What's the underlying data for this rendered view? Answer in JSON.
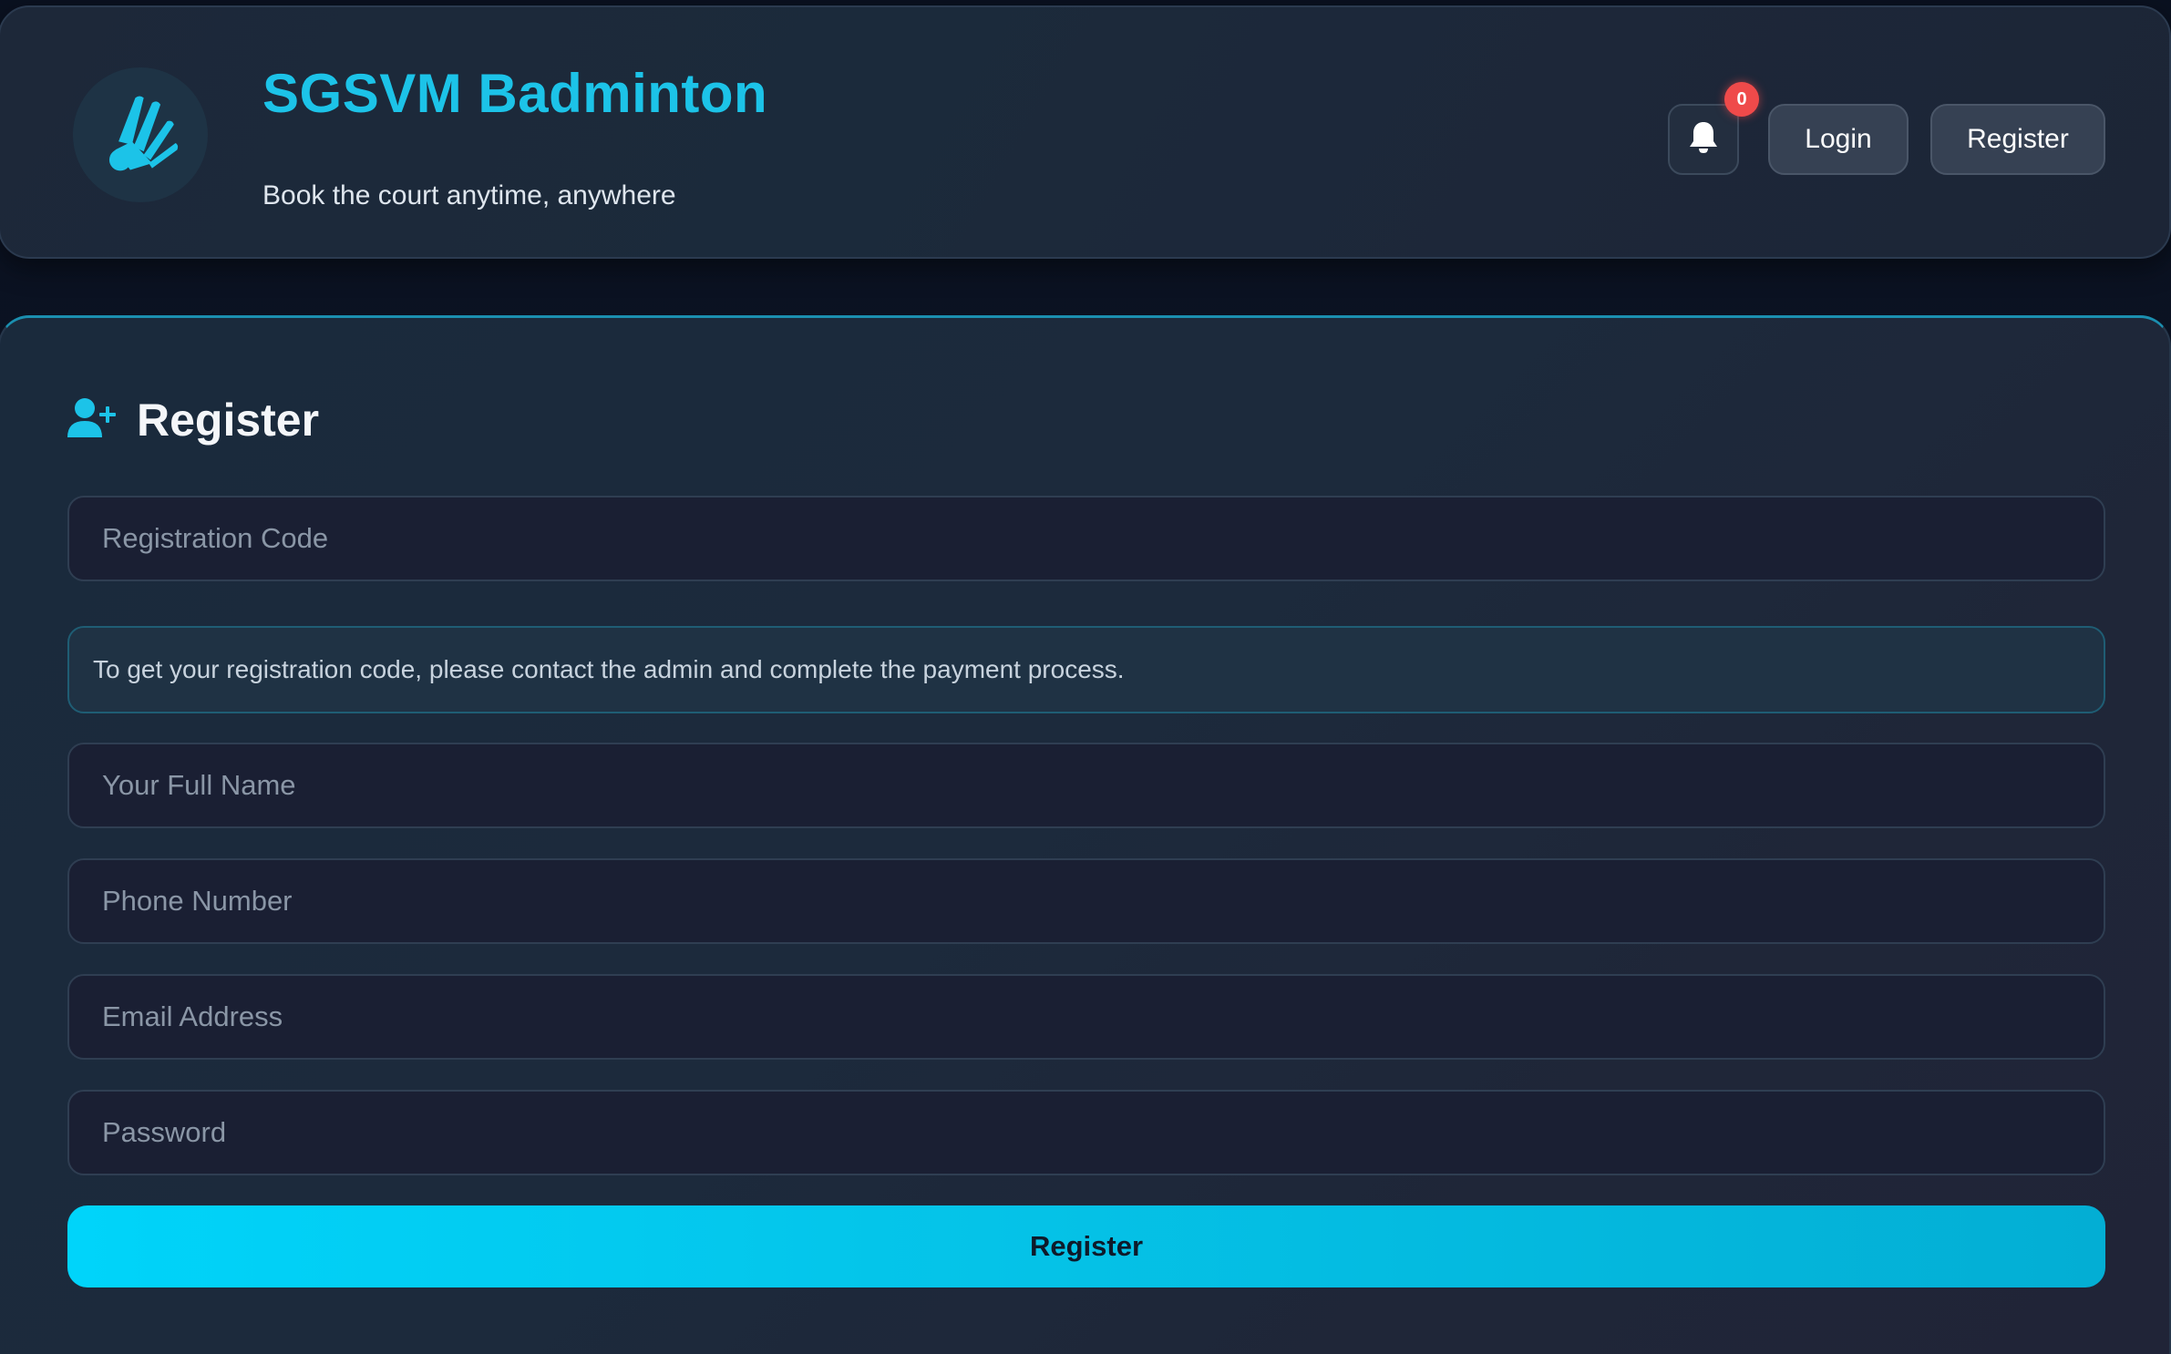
{
  "header": {
    "brand_title": "SGSVM Badminton",
    "brand_subtitle": "Book the court anytime, anywhere",
    "logo_icon": "shuttlecock-icon",
    "notifications_icon": "bell-icon",
    "notification_count": "0",
    "login_label": "Login",
    "register_label": "Register"
  },
  "register_form": {
    "title": "Register",
    "title_icon": "user-plus-icon",
    "registration_code_placeholder": "Registration Code",
    "info_text": "To get your registration code, please contact the admin and complete the payment process.",
    "full_name_placeholder": "Your Full Name",
    "phone_placeholder": "Phone Number",
    "email_placeholder": "Email Address",
    "password_placeholder": "Password",
    "submit_label": "Register"
  },
  "colors": {
    "accent": "#1cc3e8",
    "badge": "#ef4a4a",
    "submit_start": "#00d4fa",
    "submit_end": "#03aed4"
  }
}
